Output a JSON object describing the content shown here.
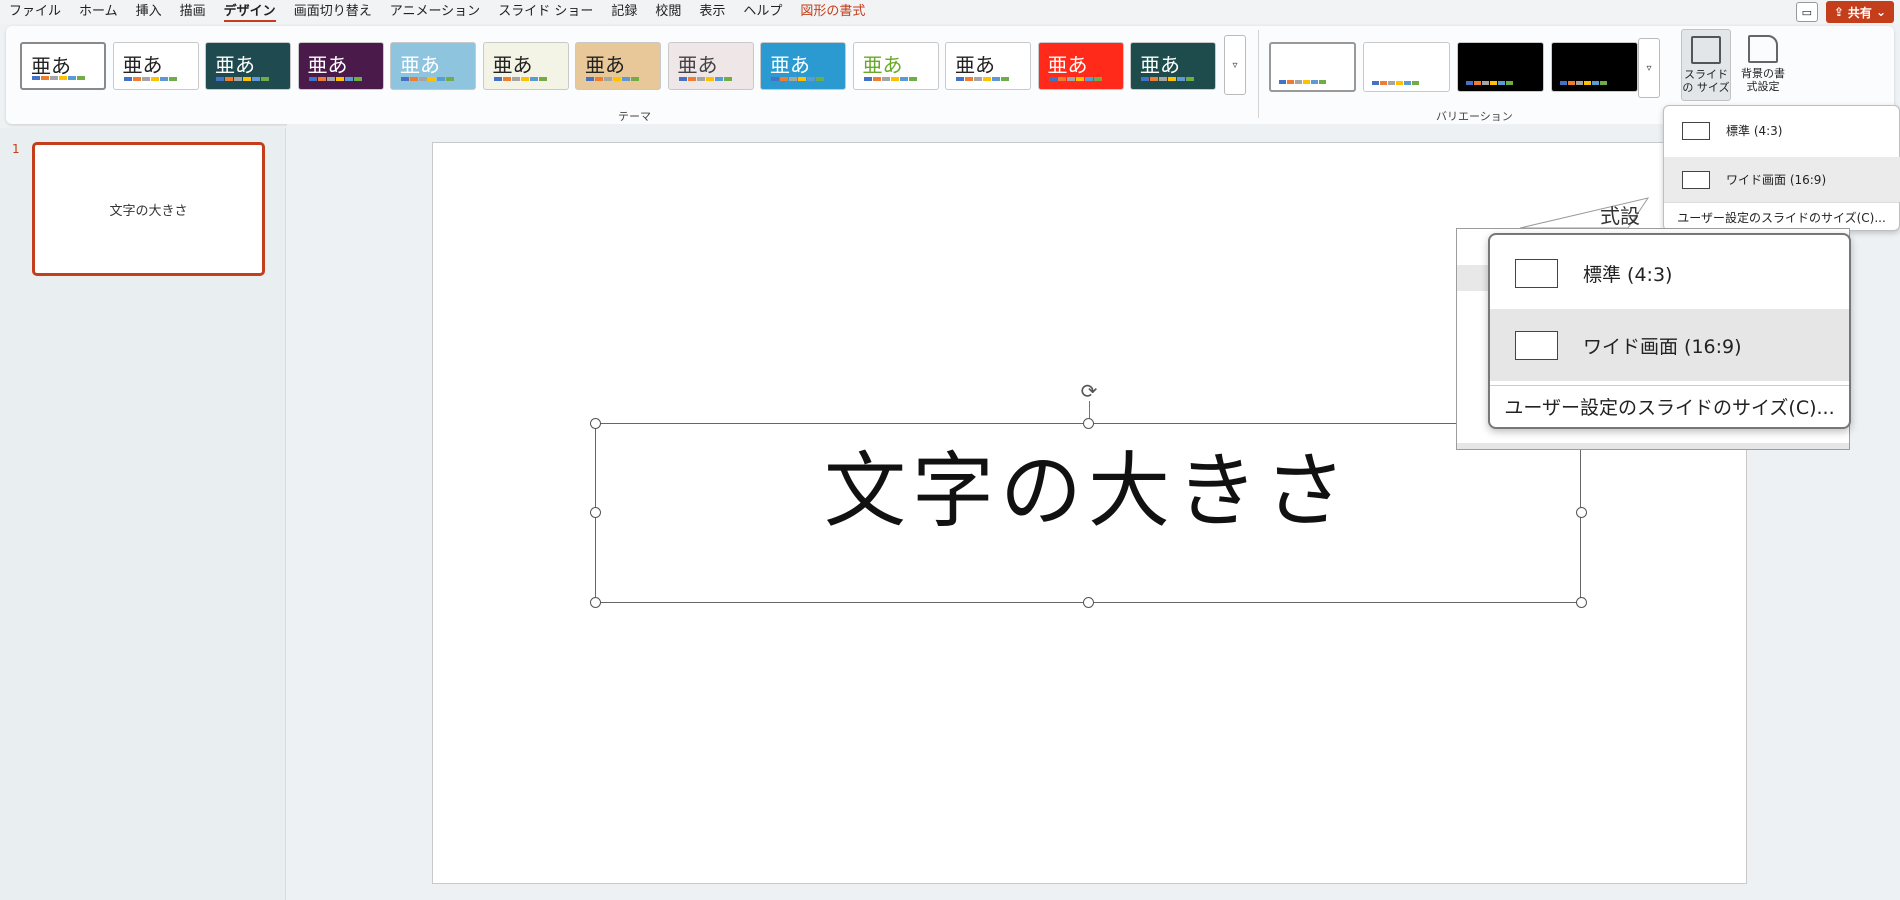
{
  "menu": {
    "tabs": [
      {
        "label": "ファイル"
      },
      {
        "label": "ホーム"
      },
      {
        "label": "挿入"
      },
      {
        "label": "描画"
      },
      {
        "label": "デザイン"
      },
      {
        "label": "画面切り替え"
      },
      {
        "label": "アニメーション"
      },
      {
        "label": "スライド ショー"
      },
      {
        "label": "記録"
      },
      {
        "label": "校閲"
      },
      {
        "label": "表示"
      },
      {
        "label": "ヘルプ"
      },
      {
        "label": "図形の書式"
      }
    ],
    "active_tab": "デザイン",
    "share_label": "共有"
  },
  "ribbon": {
    "themes_label": "テーマ",
    "variations_label": "バリエーション",
    "theme_sample_text": "亜あ",
    "slide_size_label": "スライドの サイズ",
    "background_label": "背景の書 式設定",
    "theme_colors": [
      [
        "#ffffff",
        "#222222"
      ],
      [
        "#ffffff",
        "#222222"
      ],
      [
        "#1f4a4f",
        "#ffffff"
      ],
      [
        "#4a1a4a",
        "#ffffff"
      ],
      [
        "#8fc4df",
        "#ffffff"
      ],
      [
        "#f3f4e6",
        "#222222"
      ],
      [
        "#e8c898",
        "#222222"
      ],
      [
        "#efe6e8",
        "#444444"
      ],
      [
        "#2a9ad0",
        "#ffffff"
      ],
      [
        "#ffffff",
        "#6aa82a"
      ],
      [
        "#ffffff",
        "#222222"
      ],
      [
        "#ff2a1a",
        "#ffffff"
      ],
      [
        "#1e4c4c",
        "#ffffff"
      ]
    ],
    "variant_colors": [
      "#ffffff",
      "#ffffff",
      "#000000",
      "#000000"
    ]
  },
  "slides_pane": {
    "slide_number": "1",
    "thumb_title": "文字の大きさ"
  },
  "slide": {
    "title": "文字の大きさ"
  },
  "slide_size_menu": {
    "standard": "標準 (4:3)",
    "wide": "ワイド画面 (16:9)",
    "custom": "ユーザー設定のスライドのサイズ(C)..."
  },
  "callout": {
    "peek_text": "式設"
  }
}
